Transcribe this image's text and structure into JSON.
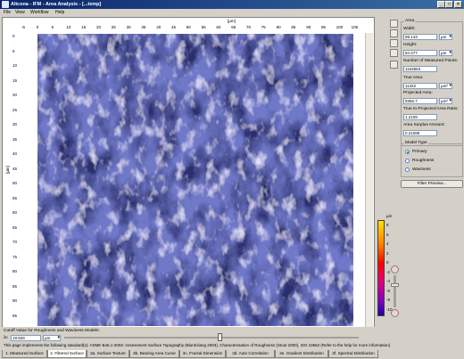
{
  "window": {
    "title": "Alicona - IFM - Area Analysis - [...temp]",
    "controls": [
      "_",
      "□",
      "×"
    ]
  },
  "menu": [
    "File",
    "View",
    "Workflow",
    "Help"
  ],
  "top_ruler": {
    "unit": "[µm]",
    "ticks": [
      "-5",
      "0",
      "5",
      "10",
      "15",
      "20",
      "25",
      "30",
      "35",
      "40",
      "45",
      "50",
      "55",
      "60",
      "65",
      "70",
      "75",
      "80",
      "85",
      "90",
      "95",
      "100",
      "105"
    ]
  },
  "left_ruler": {
    "unit": "[µm]",
    "ticks": [
      "0",
      "5",
      "10",
      "15",
      "20",
      "25",
      "30",
      "35",
      "40",
      "45",
      "50",
      "55",
      "60",
      "65",
      "70",
      "75",
      "80",
      "85",
      "90",
      "95"
    ]
  },
  "panel": {
    "area_title": "Area",
    "width_label": "Width:",
    "width_value": "99.143",
    "width_unit": "µm",
    "height_label": "Height:",
    "height_value": "94.477",
    "height_unit": "µm",
    "points_label": "Number of Measured Points:",
    "points_value": "1163553",
    "true_area_label": "True Area:",
    "true_area_value": "11342",
    "true_area_unit": "µm²",
    "projected_label": "Projected Area:",
    "projected_value": "9366.7",
    "projected_unit": "µm²",
    "ratio_label": "True to Projected Area Ratio:",
    "ratio_value": "1.2109",
    "surplus_label": "Area Surplus Amount:",
    "surplus_value": "0.21089",
    "model_title": "Model Type",
    "models": [
      "Primary",
      "Roughness",
      "Waviness"
    ],
    "selected_model": "Primary",
    "filter_button": "Filter Preview..."
  },
  "colorbar": {
    "unit": "µm",
    "labels": [
      "8",
      "6",
      "4",
      "2",
      "0",
      "-2",
      "-4",
      "-6",
      "-8",
      "-10"
    ]
  },
  "cutoff": {
    "label": "Cutoff Value for Roughness and Waviness Models:",
    "symbol": "λc",
    "value": "19.829",
    "unit": "µm"
  },
  "status_text": "This page implements the following standard(s): ASME B46.1-2002: Assessment Surface Topography (Blunt/Jiang 2003), Characterisation of Roughness (Stout 2000), ISO 10562 (Refer to the help for more information)",
  "tabs": [
    "1. Measured Surface",
    "2. Filtered Surface",
    "3a. Surface Texture",
    "3b. Bearing Area Curve",
    "3c. Fractal Dimension",
    "3d. Auto Correlation",
    "3e. Gradient Distribution",
    "3f. Spectral Distribution"
  ],
  "active_tab": "2. Filtered Surface",
  "colors": {
    "titlebar": "#0a246a",
    "surface_base": "#6f78c8",
    "surface_dark": "#2a2f6e",
    "surface_light": "#d7d6f6"
  }
}
